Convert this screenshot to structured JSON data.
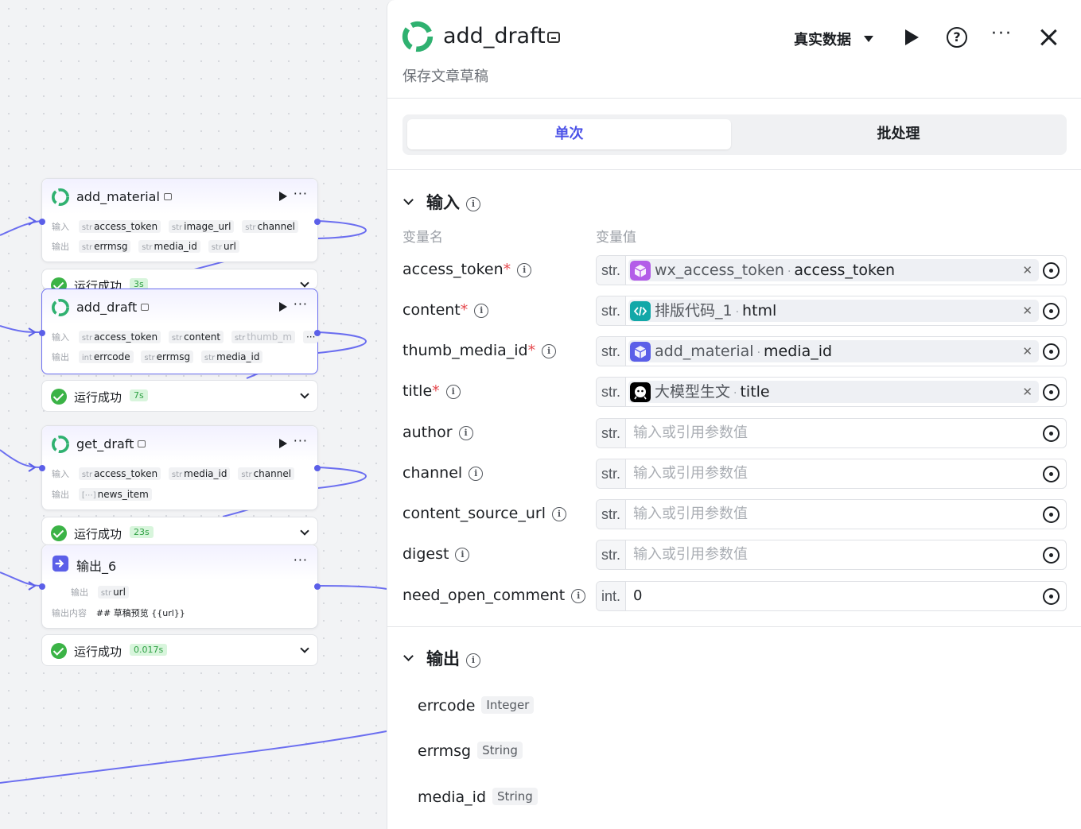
{
  "canvas": {
    "nodes": [
      {
        "title": "add_material",
        "input_label": "输入",
        "output_label": "输出",
        "inputs": [
          {
            "type": "str",
            "name": "access_token"
          },
          {
            "type": "str",
            "name": "image_url"
          },
          {
            "type": "str",
            "name": "channel"
          }
        ],
        "outputs": [
          {
            "type": "str",
            "name": "errmsg"
          },
          {
            "type": "str",
            "name": "media_id"
          },
          {
            "type": "str",
            "name": "url"
          }
        ],
        "status": "运行成功",
        "duration": "3s"
      },
      {
        "title": "add_draft",
        "input_label": "输入",
        "output_label": "输出",
        "inputs": [
          {
            "type": "str",
            "name": "access_token"
          },
          {
            "type": "str",
            "name": "content"
          },
          {
            "type": "str",
            "name": "thumb_m"
          }
        ],
        "outputs": [
          {
            "type": "int",
            "name": "errcode"
          },
          {
            "type": "str",
            "name": "errmsg"
          },
          {
            "type": "str",
            "name": "media_id"
          }
        ],
        "more": "···",
        "status": "运行成功",
        "duration": "7s"
      },
      {
        "title": "get_draft",
        "input_label": "输入",
        "output_label": "输出",
        "inputs": [
          {
            "type": "str",
            "name": "access_token"
          },
          {
            "type": "str",
            "name": "media_id"
          },
          {
            "type": "str",
            "name": "channel"
          }
        ],
        "outputs": [
          {
            "type": "[⋯]",
            "name": "news_item"
          }
        ],
        "status": "运行成功",
        "duration": "23s"
      },
      {
        "title": "输出_6",
        "output_label": "输出",
        "outputs": [
          {
            "type": "str",
            "name": "url"
          }
        ],
        "content_label": "输出内容",
        "content": "## 草稿预览 {{url}}",
        "status": "运行成功",
        "duration": "0.017s"
      }
    ]
  },
  "panel": {
    "title": "add_draft",
    "subtitle": "保存文章草稿",
    "data_mode": "真实数据",
    "tabs": [
      "单次",
      "批处理"
    ],
    "input_section": "输入",
    "col_name": "变量名",
    "col_value": "变量值",
    "params": [
      {
        "name": "access_token",
        "required": true,
        "type": "str.",
        "ref_node": "wx_access_token",
        "ref_field": "access_token",
        "icon": "cube-icon",
        "color": "#b35de8"
      },
      {
        "name": "content",
        "required": true,
        "type": "str.",
        "ref_node": "排版代码_1",
        "ref_field": "html",
        "icon": "code-icon",
        "color": "#13a8a8"
      },
      {
        "name": "thumb_media_id",
        "required": true,
        "type": "str.",
        "ref_node": "add_material",
        "ref_field": "media_id",
        "icon": "cube-icon",
        "color": "#5b5fe8"
      },
      {
        "name": "title",
        "required": true,
        "type": "str.",
        "ref_node": "大模型生文",
        "ref_field": "title",
        "icon": "bot-icon",
        "color": "#000000"
      },
      {
        "name": "author",
        "required": false,
        "type": "str.",
        "placeholder": "输入或引用参数值"
      },
      {
        "name": "channel",
        "required": false,
        "type": "str.",
        "placeholder": "输入或引用参数值"
      },
      {
        "name": "content_source_url",
        "required": false,
        "type": "str.",
        "placeholder": "输入或引用参数值"
      },
      {
        "name": "digest",
        "required": false,
        "type": "str.",
        "placeholder": "输入或引用参数值"
      },
      {
        "name": "need_open_comment",
        "required": false,
        "type": "int.",
        "value": "0"
      }
    ],
    "output_section": "输出",
    "outputs": [
      {
        "name": "errcode",
        "type": "Integer"
      },
      {
        "name": "errmsg",
        "type": "String"
      },
      {
        "name": "media_id",
        "type": "String"
      }
    ]
  },
  "colors": {
    "accent": "#4d53e8",
    "port": "#5b5fe8",
    "success": "#3bb346",
    "required": "#e5484d"
  }
}
